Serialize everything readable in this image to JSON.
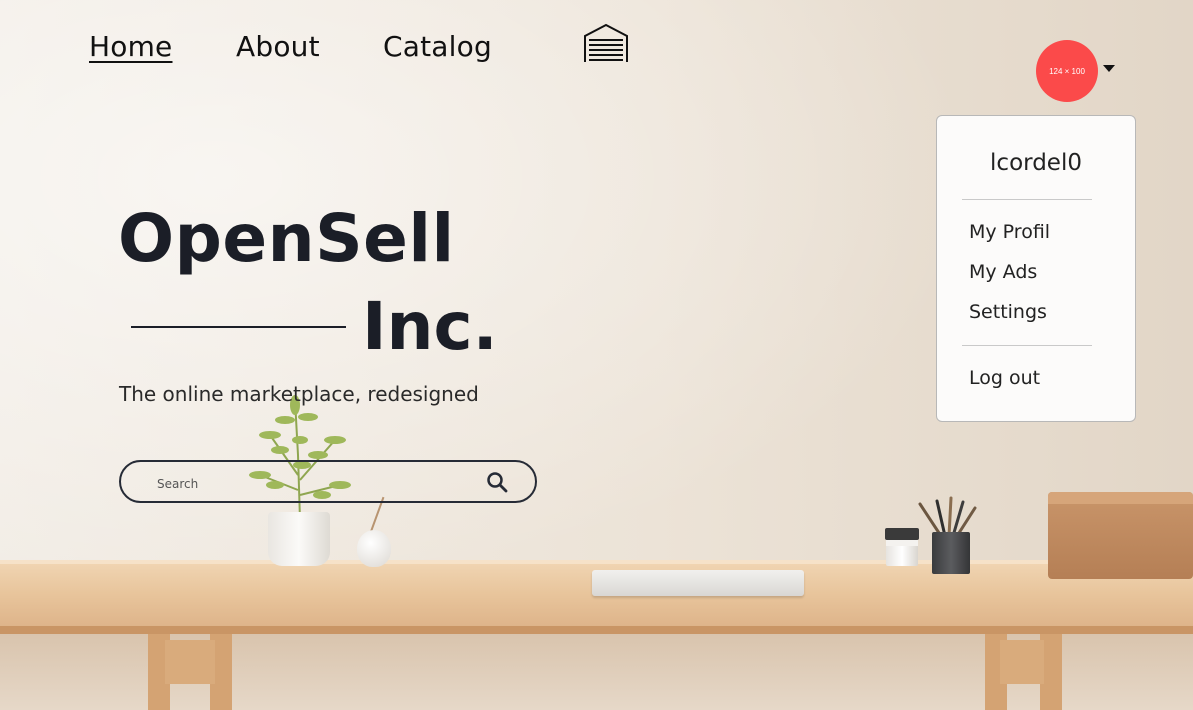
{
  "nav": {
    "links": [
      {
        "label": "Home",
        "active": true
      },
      {
        "label": "About",
        "active": false
      },
      {
        "label": "Catalog",
        "active": false
      }
    ],
    "logo_icon": "storefront-icon"
  },
  "user": {
    "avatar_text": "124 × 100",
    "avatar_color": "#fb4a4a",
    "username": "lcordel0"
  },
  "dropdown": {
    "items": [
      "My Profil",
      "My Ads",
      "Settings"
    ],
    "logout": "Log out"
  },
  "hero": {
    "title_line1": "OpenSell",
    "title_line2": "Inc.",
    "subtitle": "The online marketplace, redesigned"
  },
  "search": {
    "placeholder": "Search",
    "icon": "search-icon"
  },
  "colors": {
    "text_dark": "#1b1e27"
  }
}
